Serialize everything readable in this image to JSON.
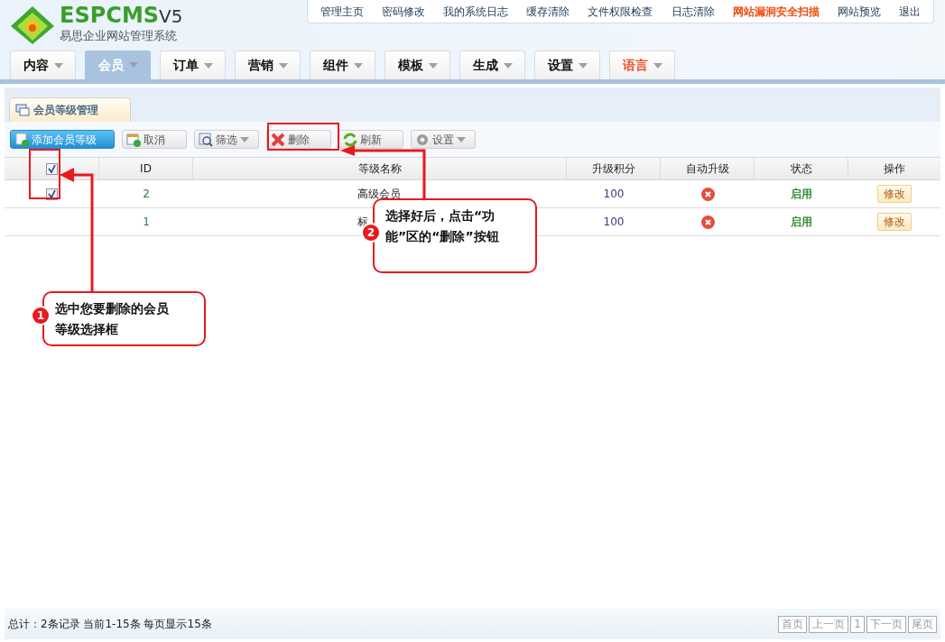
{
  "logo": {
    "brand": "ESPCMS",
    "version": "V5",
    "subtitle": "易思企业网站管理系统"
  },
  "top_links": [
    {
      "label": "管理主页",
      "highlighted": false
    },
    {
      "label": "密码修改",
      "highlighted": false
    },
    {
      "label": "我的系统日志",
      "highlighted": false
    },
    {
      "label": "缓存清除",
      "highlighted": false
    },
    {
      "label": "文件权限检查",
      "highlighted": false
    },
    {
      "label": "日志清除",
      "highlighted": false
    },
    {
      "label": "网站漏洞安全扫描",
      "highlighted": true
    },
    {
      "label": "网站预览",
      "highlighted": false
    },
    {
      "label": "退出",
      "highlighted": false
    }
  ],
  "nav_tabs": [
    {
      "label": "内容",
      "selected": false,
      "highlighted": false
    },
    {
      "label": "会员",
      "selected": true,
      "highlighted": false
    },
    {
      "label": "订单",
      "selected": false,
      "highlighted": false
    },
    {
      "label": "营销",
      "selected": false,
      "highlighted": false
    },
    {
      "label": "组件",
      "selected": false,
      "highlighted": false
    },
    {
      "label": "模板",
      "selected": false,
      "highlighted": false
    },
    {
      "label": "生成",
      "selected": false,
      "highlighted": false
    },
    {
      "label": "设置",
      "selected": false,
      "highlighted": false
    },
    {
      "label": "语言",
      "selected": false,
      "highlighted": true
    }
  ],
  "panel_tab": {
    "label": "会员等级管理"
  },
  "toolbar": [
    {
      "label": "添加会员等级",
      "kind": "add",
      "primary": true,
      "dropdown": false
    },
    {
      "label": "取消",
      "kind": "cancel",
      "primary": false,
      "dropdown": false
    },
    {
      "label": "筛选",
      "kind": "filter",
      "primary": false,
      "dropdown": true
    },
    {
      "label": "删除",
      "kind": "delete",
      "primary": false,
      "dropdown": false
    },
    {
      "label": "刷新",
      "kind": "refresh",
      "primary": false,
      "dropdown": false
    },
    {
      "label": "设置",
      "kind": "settings",
      "primary": false,
      "dropdown": true
    }
  ],
  "table": {
    "select_all": {
      "checked": true
    },
    "columns": [
      "ID",
      "等级名称",
      "升级积分",
      "自动升级",
      "状态",
      "操作"
    ],
    "rows": [
      {
        "checked": true,
        "id": "2",
        "name": "高级会员",
        "points": "100",
        "auto_upgrade": false,
        "status": "启用",
        "action": "修改"
      },
      {
        "checked": false,
        "id": "1",
        "name": "标",
        "points": "100",
        "auto_upgrade": false,
        "status": "启用",
        "action": "修改"
      }
    ]
  },
  "footer": {
    "summary": "总计：2条记录 当前1-15条 每页显示15条",
    "pager": [
      "首页",
      "上一页",
      "1",
      "下一页",
      "尾页"
    ]
  },
  "annotations": [
    {
      "number": "1",
      "text": "选中您要删除的会员等级选择框"
    },
    {
      "number": "2",
      "text": "选择好后，点击“功能”区的“删除”按钮"
    }
  ]
}
